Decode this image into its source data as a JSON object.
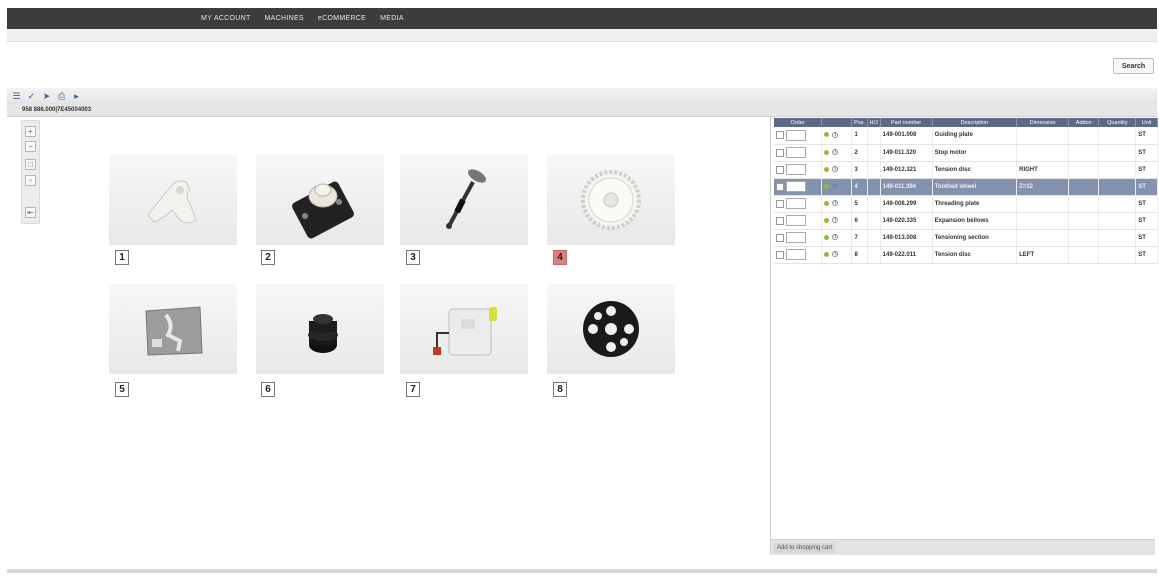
{
  "nav": {
    "items": [
      "MY ACCOUNT",
      "MACHINES",
      "eCOMMERCE",
      "MEDIA"
    ]
  },
  "search": {
    "label": "Search"
  },
  "toolbar": {
    "icons": [
      "list-icon",
      "select-icon",
      "pointer-icon",
      "print-icon",
      "arrow-right-icon"
    ]
  },
  "breadcrumb": {
    "path": "958 886.000|7E45004003"
  },
  "zoom": {
    "icons": [
      "zoom-in-icon",
      "zoom-out-icon",
      "fit-icon",
      "reset-icon",
      "export-icon"
    ]
  },
  "parts": [
    {
      "label": "1",
      "icon": "guiding-plate-icon"
    },
    {
      "label": "2",
      "icon": "stop-motor-icon"
    },
    {
      "label": "3",
      "icon": "tension-disc-icon"
    },
    {
      "label": "4",
      "icon": "toothed-wheel-icon"
    },
    {
      "label": "5",
      "icon": "threading-plate-icon"
    },
    {
      "label": "6",
      "icon": "expansion-bellows-icon"
    },
    {
      "label": "7",
      "icon": "tensioning-section-icon"
    },
    {
      "label": "8",
      "icon": "wheel-icon"
    }
  ],
  "selected_part": "4",
  "table": {
    "headers": [
      "Order",
      "",
      "Pos.",
      "H/J",
      "Part number",
      "Description",
      "Dimension",
      "Addon",
      "Quantity",
      "Unit"
    ],
    "rows": [
      {
        "pos": "1",
        "part_number": "149-001.008",
        "description": "Guiding plate",
        "dimension": "",
        "unit": "ST"
      },
      {
        "pos": "2",
        "part_number": "149-011.320",
        "description": "Stop motor",
        "dimension": "",
        "unit": "ST"
      },
      {
        "pos": "3",
        "part_number": "149-012.321",
        "description": "Tension disc",
        "dimension": "RIGHT",
        "unit": "ST"
      },
      {
        "pos": "4",
        "part_number": "149-011.394",
        "description": "Toothed wheel",
        "dimension": "Z=32",
        "unit": "ST"
      },
      {
        "pos": "5",
        "part_number": "149-008.299",
        "description": "Threading plate",
        "dimension": "",
        "unit": "ST"
      },
      {
        "pos": "6",
        "part_number": "149-020.335",
        "description": "Expansion bellows",
        "dimension": "",
        "unit": "ST"
      },
      {
        "pos": "7",
        "part_number": "149-013.008",
        "description": "Tensioning section",
        "dimension": "",
        "unit": "ST"
      },
      {
        "pos": "8",
        "part_number": "149-022.011",
        "description": "Tension disc",
        "dimension": "LEFT",
        "unit": "ST"
      }
    ]
  },
  "cart": {
    "label": "Add to shopping cart"
  },
  "colors": {
    "header": "#3c3c3c",
    "table_header": "#5c6a86",
    "selected_row": "#8592ad",
    "active_label": "#d9817f"
  }
}
